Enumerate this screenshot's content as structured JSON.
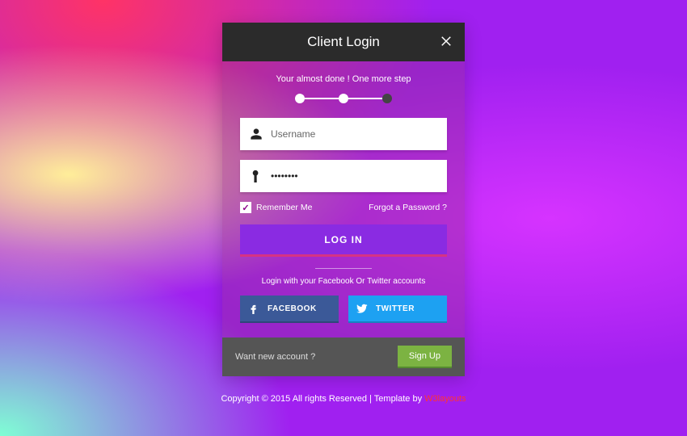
{
  "header": {
    "title": "Client Login"
  },
  "subtitle": "Your almost done ! One more step",
  "fields": {
    "username": {
      "placeholder": "Username",
      "value": ""
    },
    "password": {
      "placeholder": "",
      "value": "••••••••"
    }
  },
  "remember": {
    "label": "Remember Me",
    "checked": true
  },
  "forgot": "Forgot a Password ?",
  "login_button": "LOG IN",
  "social_text": "Login with your Facebook Or Twitter accounts",
  "social": {
    "facebook": "FACEBOOK",
    "twitter": "TWITTER"
  },
  "footer": {
    "prompt": "Want new account ?",
    "signup": "Sign Up"
  },
  "copyright": {
    "text": "Copyright © 2015 All rights Reserved | Template by ",
    "link": "W3layouts"
  }
}
